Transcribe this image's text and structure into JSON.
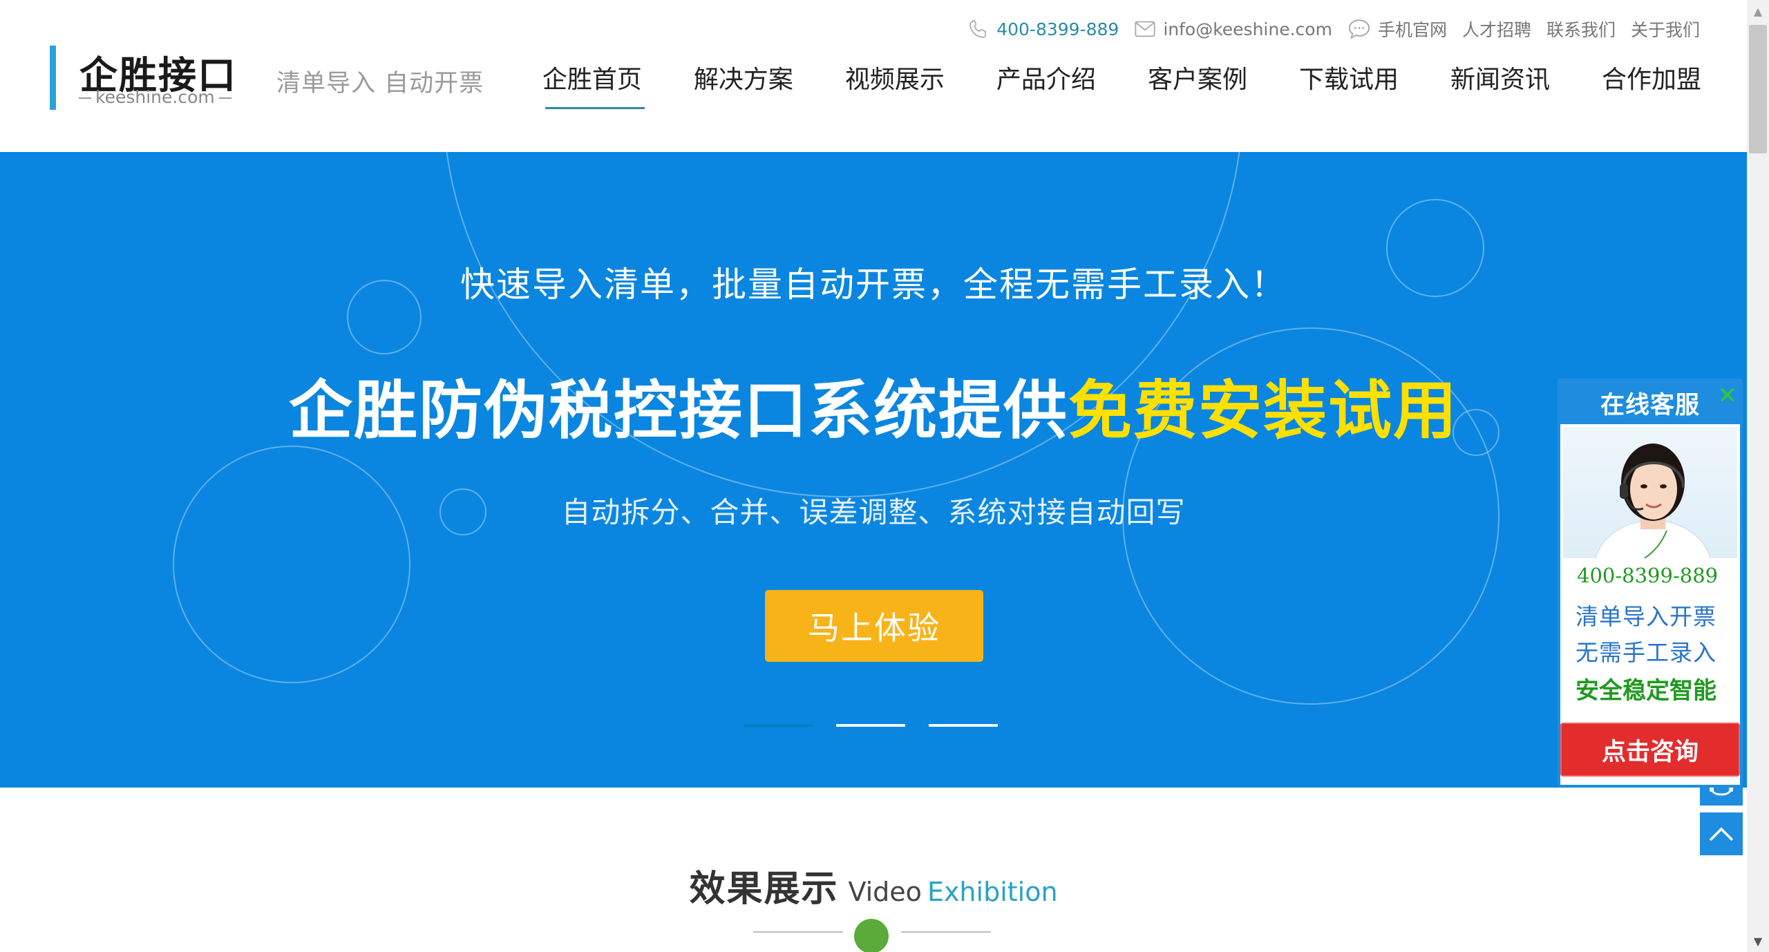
{
  "brand": {
    "logo_title": "企胜接口",
    "logo_domain": "keeshine.com",
    "slogan": "清单导入 自动开票"
  },
  "toplinks": {
    "phone": "400-8399-889",
    "email": "info@keeshine.com",
    "mobile": "手机官网",
    "jobs": "人才招聘",
    "contact": "联系我们",
    "about": "关于我们"
  },
  "nav": [
    {
      "label": "企胜首页",
      "active": true
    },
    {
      "label": "解决方案"
    },
    {
      "label": "视频展示"
    },
    {
      "label": "产品介绍"
    },
    {
      "label": "客户案例"
    },
    {
      "label": "下载试用"
    },
    {
      "label": "新闻资讯"
    },
    {
      "label": "合作加盟"
    }
  ],
  "banner": {
    "subtitle": "快速导入清单，批量自动开票，全程无需手工录入！",
    "headline_main": "企胜防伪税控接口系统提供",
    "headline_highlight": "免费安装试用",
    "description": "自动拆分、合并、误差调整、系统对接自动回写",
    "cta_label": "马上体验",
    "slide_count": 3,
    "active_slide": 1,
    "colors": {
      "background": "#0a86e0",
      "highlight": "#ffe000",
      "cta": "#f8b319"
    }
  },
  "section": {
    "title_cn": "效果展示",
    "title_en1": "Video",
    "title_en2": "Exhibition"
  },
  "chat": {
    "header": "在线客服",
    "phone": "400-8399-889",
    "line1": "清单导入开票",
    "line2": "无需手工录入",
    "line3": "安全稳定智能",
    "button": "点击咨询",
    "colors": {
      "primary": "#1e8de0",
      "button": "#e32c2c",
      "green": "#1f9a1f"
    }
  },
  "icons": [
    "phone-icon",
    "mail-icon",
    "chat-bubble-icon",
    "close-icon",
    "headset-icon",
    "back-to-top-icon"
  ]
}
